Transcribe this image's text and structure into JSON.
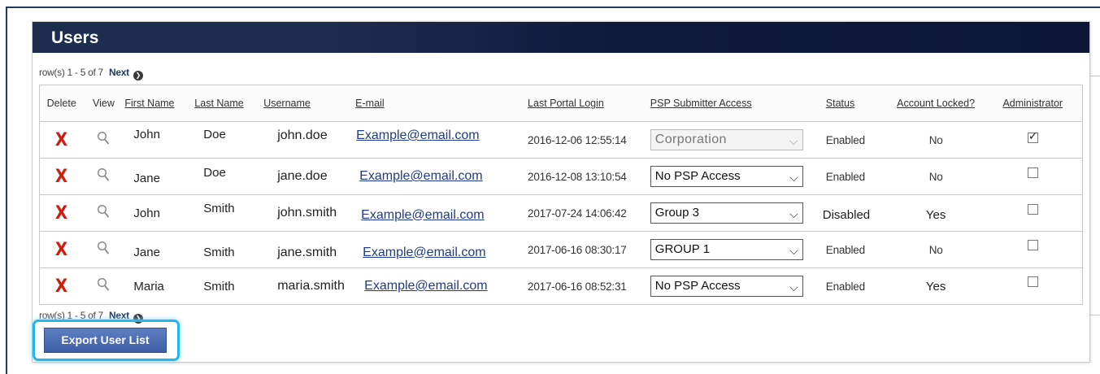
{
  "panel": {
    "title": "Users"
  },
  "pager": {
    "top_text": "row(s) 1 - 5 of 7",
    "bottom_text": "row(s) 1 - 5 of 7",
    "next_label": "Next"
  },
  "columns": {
    "delete": "Delete",
    "view": "View",
    "first_name": "First Name",
    "last_name": "Last Name",
    "username": "Username",
    "email": "E-mail",
    "last_login": "Last Portal Login",
    "psp_access": "PSP Submitter Access",
    "status": "Status",
    "locked": "Account Locked?",
    "admin": "Administrator"
  },
  "rows": [
    {
      "first": "John",
      "last": "Doe",
      "username": "john.doe",
      "email": "Example@email.com",
      "login": "2016-12-06 12:55:14",
      "psp": "Corporation",
      "psp_disabled": true,
      "status": "Enabled",
      "locked": "No",
      "admin": true
    },
    {
      "first": "Jane",
      "last": "Doe",
      "username": "jane.doe",
      "email": "Example@email.com",
      "login": "2016-12-08 13:10:54",
      "psp": "No PSP Access",
      "psp_disabled": false,
      "status": "Enabled",
      "locked": "No",
      "admin": false
    },
    {
      "first": "John",
      "last": "Smith",
      "username": "john.smith",
      "email": "Example@email.com",
      "login": "2017-07-24 14:06:42",
      "psp": "Group 3",
      "psp_disabled": false,
      "status": "Disabled",
      "locked": "Yes",
      "admin": false
    },
    {
      "first": "Jane",
      "last": "Smith",
      "username": "jane.smith",
      "email": "Example@email.com",
      "login": "2017-06-16 08:30:17",
      "psp": "GROUP 1",
      "psp_disabled": false,
      "status": "Enabled",
      "locked": "No",
      "admin": false
    },
    {
      "first": "Maria",
      "last": "Smith",
      "username": "maria.smith",
      "email": "Example@email.com",
      "login": "2017-06-16 08:52:31",
      "psp": "No PSP Access",
      "psp_disabled": false,
      "status": "Enabled",
      "locked": "Yes",
      "admin": false
    }
  ],
  "icons": {
    "delete": "delete-x-icon",
    "view": "magnifier-icon",
    "next": "next-arrow-icon",
    "dropdown": "chevron-down-icon"
  },
  "colors": {
    "header_bg": "#1d2d50",
    "delete": "#cc1f10",
    "link": "#1f3c8a",
    "export_btn": "#4a69ad",
    "highlight": "#26b6ee"
  },
  "export_button": {
    "label": "Export User List"
  }
}
